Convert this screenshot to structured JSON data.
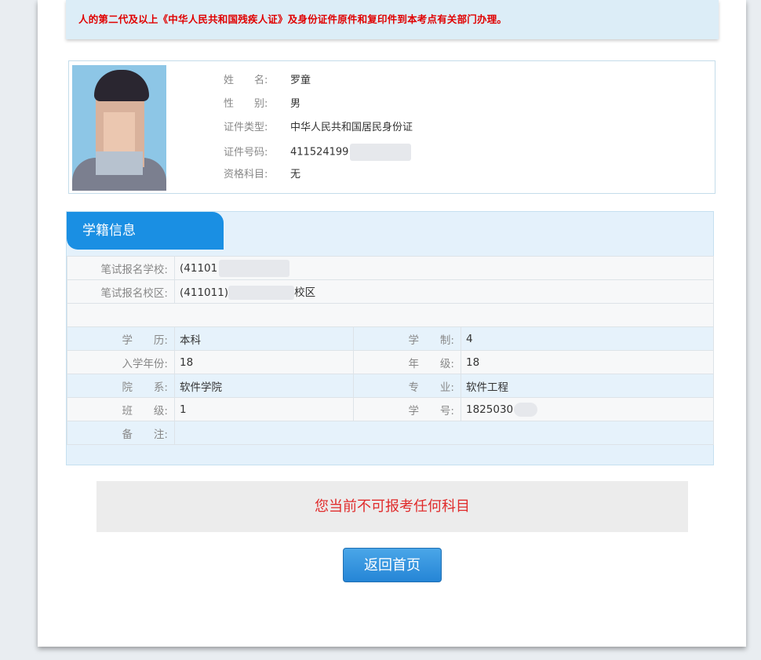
{
  "notice": {
    "text": "人的第二代及以上《中华人民共和国残疾人证》及身份证件原件和复印件到本考点有关部门办理。"
  },
  "person": {
    "rows": [
      {
        "label": "姓　　名:",
        "value": "罗童"
      },
      {
        "label": "性　　别:",
        "value": "男"
      },
      {
        "label": "证件类型:",
        "value": "中华人民共和国居民身份证"
      },
      {
        "label": "证件号码:",
        "value": "411524199"
      },
      {
        "label": "资格科目:",
        "value": "无"
      }
    ]
  },
  "school": {
    "title": "学籍信息",
    "exam_school_label": "笔试报名学校:",
    "exam_school_value": "(41101",
    "exam_campus_label": "笔试报名校区:",
    "exam_campus_value_prefix": "(411011)",
    "exam_campus_value_suffix": "校区",
    "fields": {
      "education_label": "学　　历:",
      "education_value": "本科",
      "system_label": "学　　制:",
      "system_value": "4",
      "enroll_year_label": "入学年份:",
      "enroll_year_value": "18",
      "grade_label": "年　　级:",
      "grade_value": "18",
      "department_label": "院　　系:",
      "department_value": "软件学院",
      "major_label": "专　　业:",
      "major_value": "软件工程",
      "class_label": "班　　级:",
      "class_value": "1",
      "student_id_label": "学　　号:",
      "student_id_value": "1825030",
      "remark_label": "备　　注:",
      "remark_value": ""
    }
  },
  "message": "您当前不可报考任何科目",
  "back_button": "返回首页"
}
